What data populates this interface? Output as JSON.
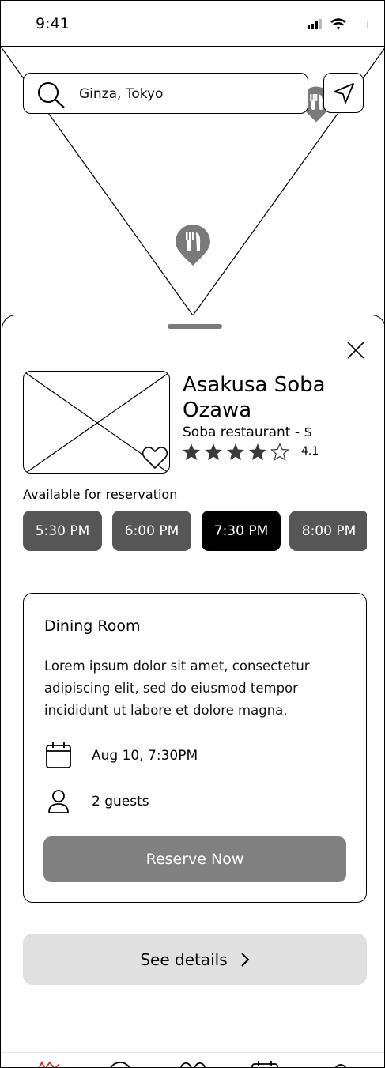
{
  "status_bar": {
    "time": "9:41"
  },
  "search": {
    "query": "Ginza, Tokyo"
  },
  "restaurant": {
    "name": "Asakusa Soba Ozawa",
    "type": "Soba restaurant - $",
    "rating": "4.1",
    "stars_filled": 4,
    "stars_total": 5
  },
  "reservation": {
    "label": "Available for reservation",
    "slots": [
      "5:30 PM",
      "6:00 PM",
      "7:30 PM",
      "8:00 PM"
    ],
    "selected_slot": "7:30 PM"
  },
  "card": {
    "title": "Dining Room",
    "description": "Lorem ipsum dolor sit amet, consectetur adipiscing elit, sed do eiusmod tempor incididunt ut labore et dolore magna.",
    "date": "Aug 10, 7:30PM",
    "guests": "2 guests",
    "reserve_label": "Reserve Now"
  },
  "details_label": "See details",
  "colors": {
    "slot": "#565656",
    "slot_selected": "#000000",
    "reserve_button": "#808080",
    "details_button": "#e0e0e0",
    "active_tab": "#c0392b"
  },
  "tab_bar": {
    "icons": [
      "food-icon",
      "search-icon",
      "heart-icon",
      "calendar-icon",
      "profile-icon"
    ]
  }
}
